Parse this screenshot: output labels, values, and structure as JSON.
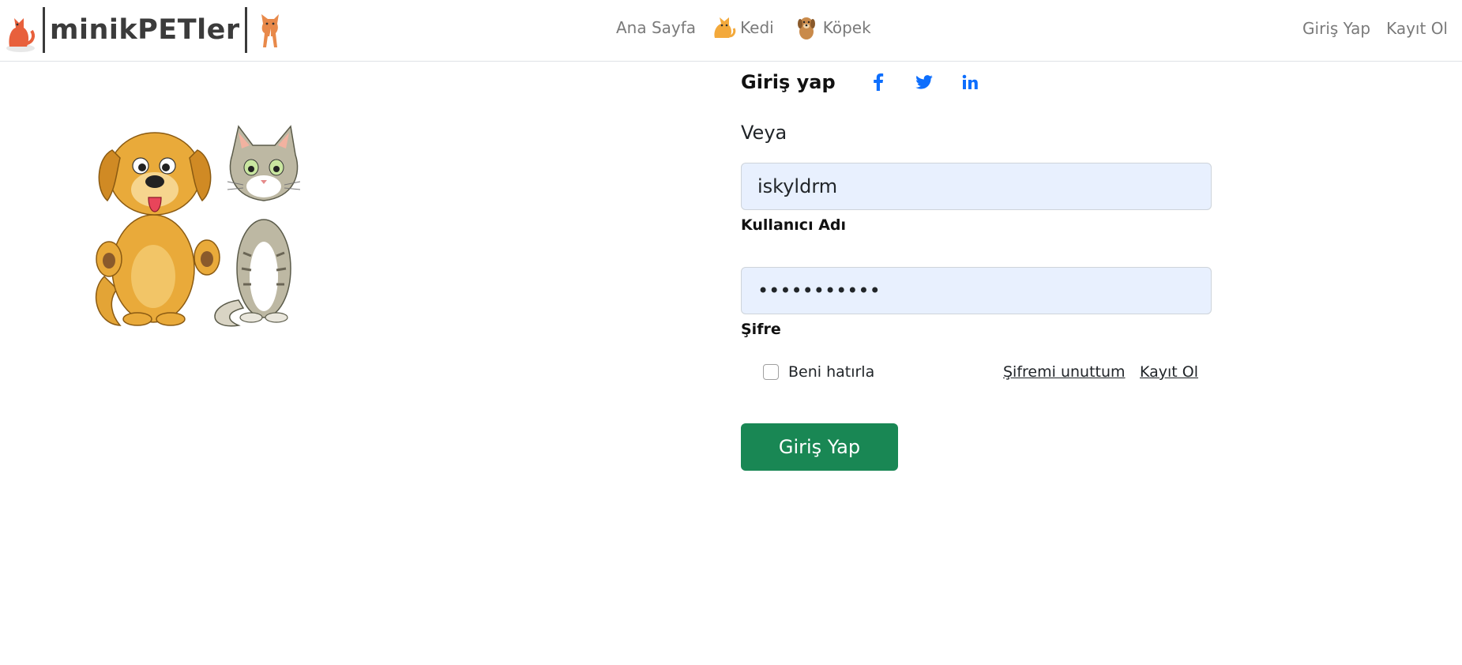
{
  "navbar": {
    "brand_text": "minikPETler",
    "links": {
      "home": "Ana Sayfa",
      "cat": "Kedi",
      "dog": "Köpek"
    },
    "auth": {
      "login": "Giriş Yap",
      "register": "Kayıt Ol"
    }
  },
  "login_form": {
    "social_title": "Giriş yap",
    "social_icons": [
      "facebook-icon",
      "twitter-icon",
      "linkedin-icon"
    ],
    "or_text": "Veya",
    "username": {
      "value": "iskyldrm",
      "label": "Kullanıcı Adı"
    },
    "password": {
      "value": "•••••••••••",
      "label": "Şifre"
    },
    "remember_label": "Beni hatırla",
    "forgot_link": "Şifremi unuttum",
    "register_link": "Kayıt Ol",
    "submit_label": "Giriş Yap"
  },
  "colors": {
    "submit_button": "#198754",
    "social_icon": "#0d6efd",
    "input_background": "#e8f0fe",
    "nav_text": "#7a7a7a"
  }
}
